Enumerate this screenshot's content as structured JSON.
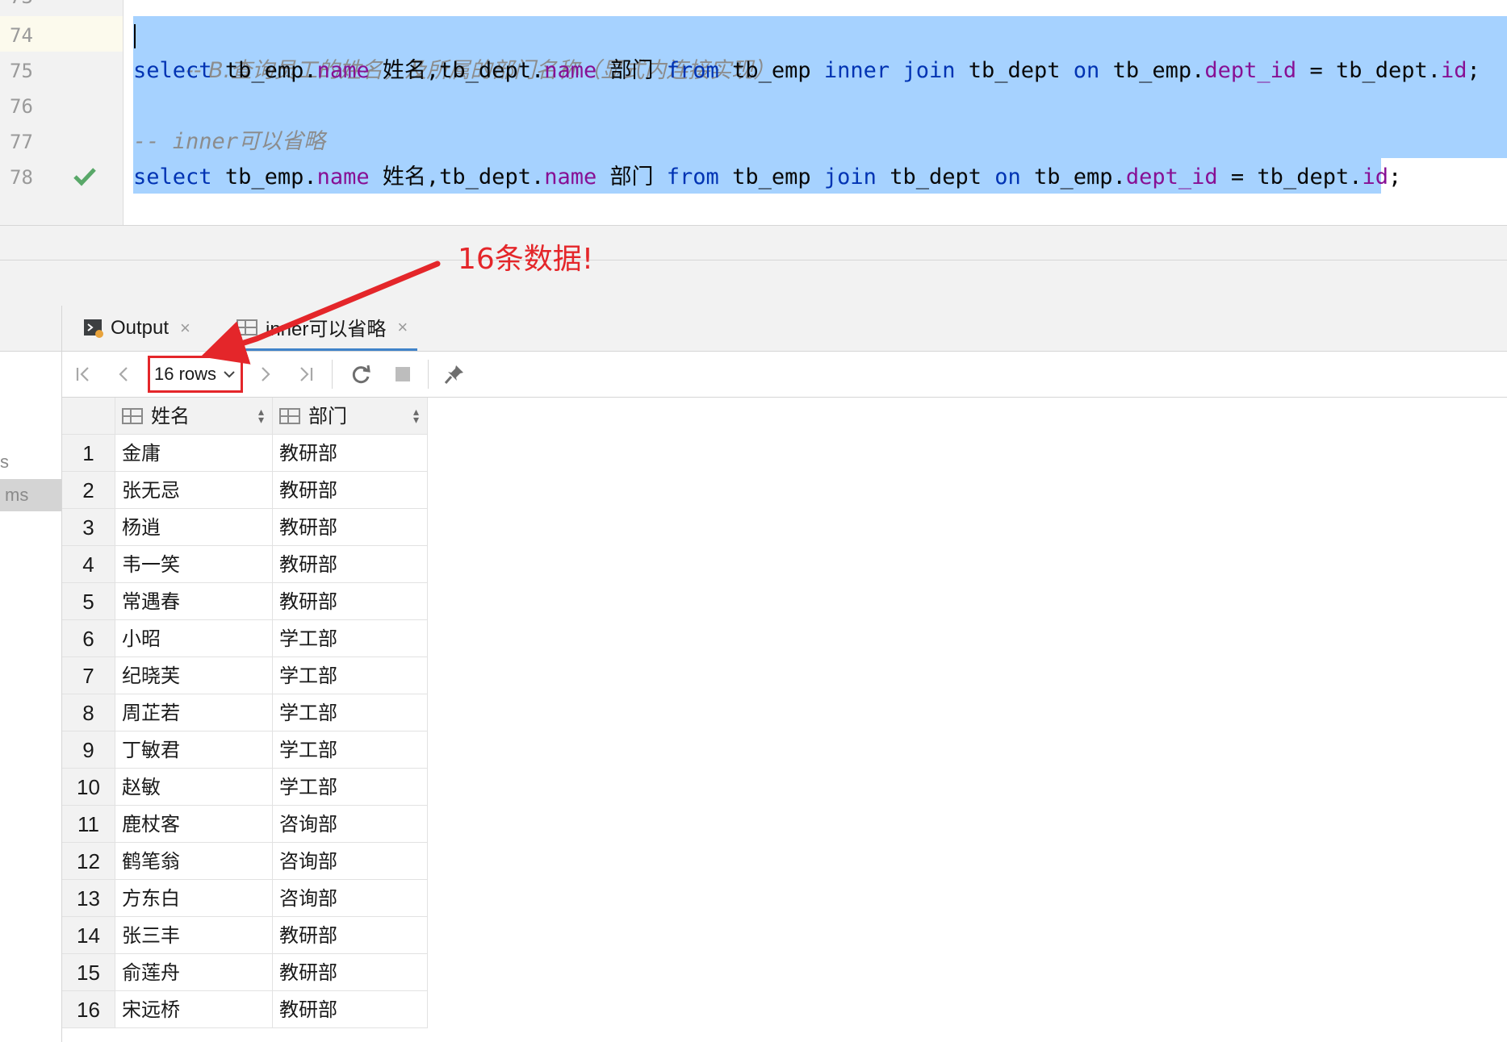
{
  "editor": {
    "line_numbers": [
      "73",
      "74",
      "75",
      "76",
      "77",
      "78"
    ],
    "lines": {
      "l74_comment": "-- B.查询员工的姓名，及所属的部门名称（显式内连接实现）",
      "l77_comment_dashes": "-- ",
      "l77_comment_word": "inner",
      "l77_comment_cn": "可以省略"
    },
    "tokens": {
      "select": "select",
      "t_emp_dot": "tb_emp.",
      "name": "name",
      "alias_name": "姓名",
      "comma_t_dept_dot": ",tb_dept.",
      "alias_dept": "部门",
      "from": "from",
      "tb_emp": "tb_emp",
      "inner": "inner",
      "join": "join",
      "tb_dept": "tb_dept",
      "on": "on",
      "dept_id": "dept_id",
      "eq": "=",
      "id": "id",
      "semi": ";"
    }
  },
  "annotation": {
    "text": "16条数据!",
    "color": "#e4262a"
  },
  "left_dock": {
    "partial_s": "s",
    "partial_ms": "ms"
  },
  "tabs": [
    {
      "label": "Output",
      "icon": "output-console-icon",
      "close": "×"
    },
    {
      "label": "inner可以省略",
      "icon": "table-icon",
      "close": "×"
    }
  ],
  "toolbar": {
    "rows_label": "16 rows",
    "icons": [
      "first-page-icon",
      "prev-page-icon",
      "next-page-icon",
      "last-page-icon",
      "refresh-icon",
      "stop-icon",
      "pin-icon"
    ]
  },
  "grid": {
    "columns": [
      "姓名",
      "部门"
    ],
    "rows": [
      [
        "1",
        "金庸",
        "教研部"
      ],
      [
        "2",
        "张无忌",
        "教研部"
      ],
      [
        "3",
        "杨逍",
        "教研部"
      ],
      [
        "4",
        "韦一笑",
        "教研部"
      ],
      [
        "5",
        "常遇春",
        "教研部"
      ],
      [
        "6",
        "小昭",
        "学工部"
      ],
      [
        "7",
        "纪晓芙",
        "学工部"
      ],
      [
        "8",
        "周芷若",
        "学工部"
      ],
      [
        "9",
        "丁敏君",
        "学工部"
      ],
      [
        "10",
        "赵敏",
        "学工部"
      ],
      [
        "11",
        "鹿杖客",
        "咨询部"
      ],
      [
        "12",
        "鹤笔翁",
        "咨询部"
      ],
      [
        "13",
        "方东白",
        "咨询部"
      ],
      [
        "14",
        "张三丰",
        "教研部"
      ],
      [
        "15",
        "俞莲舟",
        "教研部"
      ],
      [
        "16",
        "宋远桥",
        "教研部"
      ]
    ]
  },
  "colors": {
    "selection": "#a6d2ff",
    "keyword": "#0033b3",
    "field": "#871094",
    "comment": "#8c8c8c",
    "accent": "#4083c9"
  }
}
